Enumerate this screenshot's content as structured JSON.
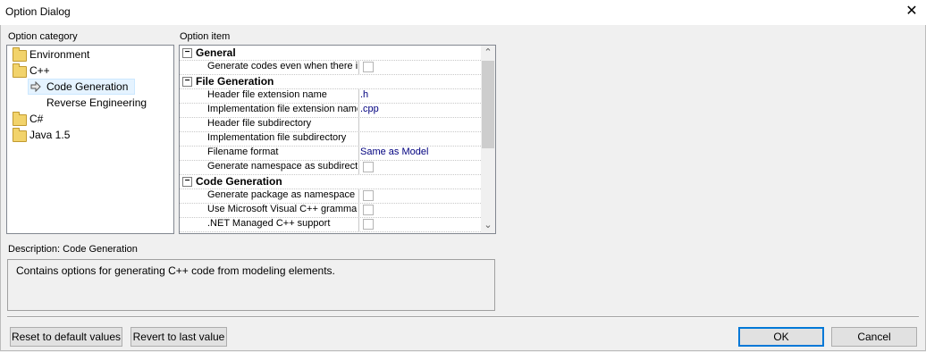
{
  "window": {
    "title": "Option Dialog",
    "close_glyph": "✕"
  },
  "category": {
    "label": "Option category",
    "items": [
      {
        "label": "Environment",
        "icon": "folder-icon"
      },
      {
        "label": "C++",
        "icon": "folder-icon"
      },
      {
        "label": "Code Generation",
        "icon": "arrow-icon",
        "selected": true
      },
      {
        "label": "Reverse Engineering",
        "icon": ""
      },
      {
        "label": "C#",
        "icon": "folder-icon"
      },
      {
        "label": "Java 1.5",
        "icon": "folder-icon"
      }
    ]
  },
  "options": {
    "label": "Option item",
    "groups": [
      {
        "title": "General",
        "toggle": "−",
        "rows": [
          {
            "name": "Generate codes even when there is",
            "value": "",
            "checkbox": true
          }
        ]
      },
      {
        "title": "File Generation",
        "toggle": "−",
        "rows": [
          {
            "name": "Header file extension name",
            "value": ".h"
          },
          {
            "name": "Implementation file extension name",
            "value": ".cpp"
          },
          {
            "name": "Header file subdirectory",
            "value": ""
          },
          {
            "name": "Implementation file subdirectory",
            "value": ""
          },
          {
            "name": "Filename format",
            "value": "Same as Model"
          },
          {
            "name": "Generate namespace as subdirectory",
            "value": "",
            "checkbox": true
          }
        ]
      },
      {
        "title": "Code Generation",
        "toggle": "−",
        "rows": [
          {
            "name": "Generate package as namespace",
            "value": "",
            "checkbox": true
          },
          {
            "name": "Use Microsoft Visual C++ grammar",
            "value": "",
            "checkbox": true
          },
          {
            "name": ".NET Managed C++ support",
            "value": "",
            "checkbox": true
          }
        ]
      }
    ],
    "scroll_up": "⌃",
    "scroll_down": "⌄"
  },
  "description": {
    "label": "Description: Code Generation",
    "text": "Contains options for generating C++ code from modeling elements."
  },
  "buttons": {
    "reset": "Reset to default values",
    "revert": "Revert to last value",
    "ok": "OK",
    "cancel": "Cancel"
  },
  "colors": {
    "value_text": "#00007f",
    "selection": "#e5f3ff",
    "default_button_border": "#0078d7"
  }
}
